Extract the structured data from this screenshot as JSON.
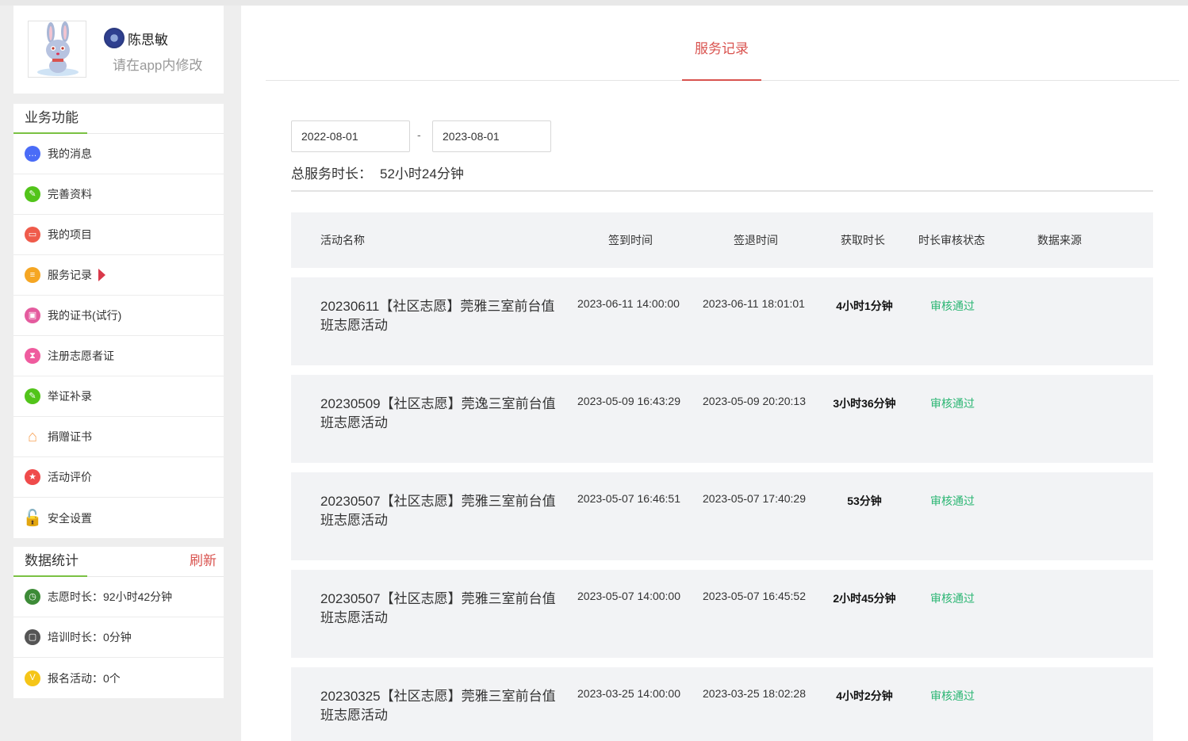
{
  "profile": {
    "name": "陈思敏",
    "hint": "请在app内修改"
  },
  "business": {
    "title": "业务功能",
    "items": [
      {
        "label": "我的消息",
        "icon": "message-icon",
        "color": "#4a6cf7"
      },
      {
        "label": "完善资料",
        "icon": "edit-icon",
        "color": "#52c41a"
      },
      {
        "label": "我的项目",
        "icon": "project-icon",
        "color": "#ef5b4b"
      },
      {
        "label": "服务记录",
        "icon": "list-icon",
        "color": "#f5a623"
      },
      {
        "label": "我的证书(试行)",
        "icon": "certificate-icon",
        "color": "#e45b9e"
      },
      {
        "label": "注册志愿者证",
        "icon": "hourglass-icon",
        "color": "#ef5b9e"
      },
      {
        "label": "举证补录",
        "icon": "edit-icon",
        "color": "#52c41a"
      },
      {
        "label": "捐赠证书",
        "icon": "house-icon",
        "color": "#f7a45a"
      },
      {
        "label": "活动评价",
        "icon": "star-icon",
        "color": "#ef4b4b"
      },
      {
        "label": "安全设置",
        "icon": "lock-icon",
        "color": "#2bb673"
      }
    ]
  },
  "stats": {
    "title": "数据统计",
    "refresh": "刷新",
    "items": [
      {
        "label": "志愿时长：92小时42分钟",
        "icon": "clock-icon",
        "color": "#3d8b37"
      },
      {
        "label": "培训时长：0分钟",
        "icon": "training-icon",
        "color": "#555555"
      },
      {
        "label": "报名活动：0个",
        "icon": "signup-icon",
        "color": "#f5c518"
      }
    ]
  },
  "main": {
    "tab": "服务记录",
    "date_from": "2022-08-01",
    "date_sep": "-",
    "date_to": "2023-08-01",
    "total_label": "总服务时长：",
    "total_value": "52小时24分钟",
    "columns": [
      "活动名称",
      "签到时间",
      "签退时间",
      "获取时长",
      "时长审核状态",
      "数据来源"
    ],
    "rows": [
      {
        "name": "20230611【社区志愿】莞雅三室前台值班志愿活动",
        "checkin": "2023-06-11 14:00:00",
        "checkout": "2023-06-11 18:01:01",
        "duration": "4小时1分钟",
        "status": "审核通过",
        "source": ""
      },
      {
        "name": "20230509【社区志愿】莞逸三室前台值班志愿活动",
        "checkin": "2023-05-09 16:43:29",
        "checkout": "2023-05-09 20:20:13",
        "duration": "3小时36分钟",
        "status": "审核通过",
        "source": ""
      },
      {
        "name": "20230507【社区志愿】莞雅三室前台值班志愿活动",
        "checkin": "2023-05-07 16:46:51",
        "checkout": "2023-05-07 17:40:29",
        "duration": "53分钟",
        "status": "审核通过",
        "source": ""
      },
      {
        "name": "20230507【社区志愿】莞雅三室前台值班志愿活动",
        "checkin": "2023-05-07 14:00:00",
        "checkout": "2023-05-07 16:45:52",
        "duration": "2小时45分钟",
        "status": "审核通过",
        "source": ""
      },
      {
        "name": "20230325【社区志愿】莞雅三室前台值班志愿活动",
        "checkin": "2023-03-25 14:00:00",
        "checkout": "2023-03-25 18:02:28",
        "duration": "4小时2分钟",
        "status": "审核通过",
        "source": ""
      }
    ]
  }
}
